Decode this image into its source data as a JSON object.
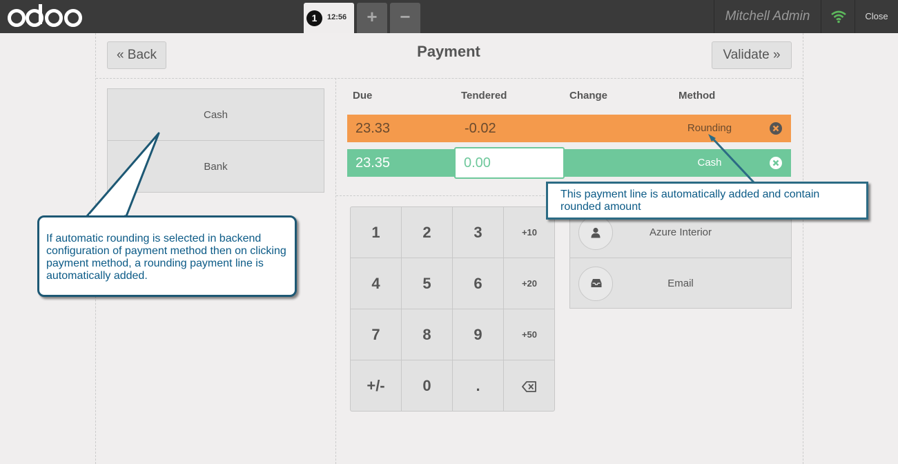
{
  "topbar": {
    "logo_text": "odoo",
    "order_number": "1",
    "order_time": "12:56",
    "add_label": "+",
    "remove_label": "−",
    "user_name": "Mitchell Admin",
    "close_label": "Close"
  },
  "header": {
    "back_label": "« Back",
    "title": "Payment",
    "validate_label": "Validate »"
  },
  "payment_methods": [
    {
      "label": "Cash"
    },
    {
      "label": "Bank"
    }
  ],
  "columns": {
    "due": "Due",
    "tendered": "Tendered",
    "change": "Change",
    "method": "Method"
  },
  "payment_lines": [
    {
      "due": "23.33",
      "tendered": "-0.02",
      "change": "",
      "method": "Rounding",
      "color": "#f49a4c"
    },
    {
      "due": "23.35",
      "tendered": "0.00",
      "change": "",
      "method": "Cash",
      "color": "#6ec89b"
    }
  ],
  "numpad": [
    "1",
    "2",
    "3",
    "+10",
    "4",
    "5",
    "6",
    "+20",
    "7",
    "8",
    "9",
    "+50",
    "+/-",
    "0",
    ".",
    "backspace"
  ],
  "customer": {
    "label": "Azure Interior",
    "icon": "user-icon"
  },
  "email": {
    "label": "Email",
    "icon": "inbox-icon"
  },
  "callouts": {
    "left": "If automatic rounding is selected in backend configuration of payment method then on clicking payment method, a rounding payment line is automatically added.",
    "right": "This payment line is automatically added and contain rounded amount"
  },
  "colors": {
    "topbar": "#3a3a3a",
    "background": "#f0eeee",
    "rounding_line": "#f49a4c",
    "cash_line": "#6ec89b",
    "callout_text": "#0b5a86",
    "callout_border": "#1d5874"
  }
}
